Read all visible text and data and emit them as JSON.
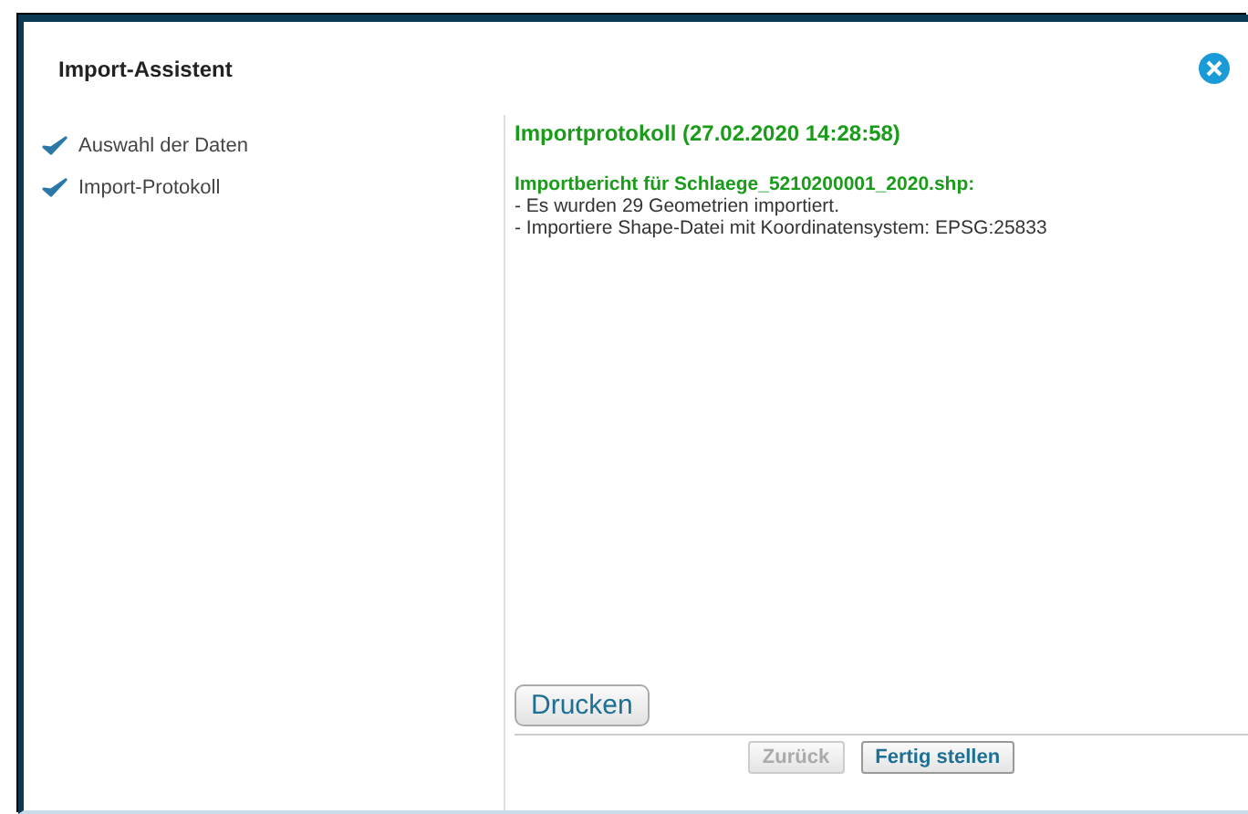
{
  "window": {
    "title": "Import-Assistent"
  },
  "steps": [
    {
      "label": "Auswahl der Daten",
      "done": true
    },
    {
      "label": "Import-Protokoll",
      "done": true
    }
  ],
  "report": {
    "heading": "Importprotokoll (27.02.2020 14:28:58)",
    "subheading": "Importbericht für Schlaege_5210200001_2020.shp:",
    "lines": [
      "- Es wurden 29 Geometrien importiert.",
      "- Importiere Shape-Datei mit Koordinatensystem: EPSG:25833"
    ]
  },
  "print_button": {
    "label": "Drucken"
  },
  "buttons": [
    {
      "label": "Zurück",
      "disabled": true
    },
    {
      "label": "Fertig stellen",
      "disabled": false
    }
  ]
}
